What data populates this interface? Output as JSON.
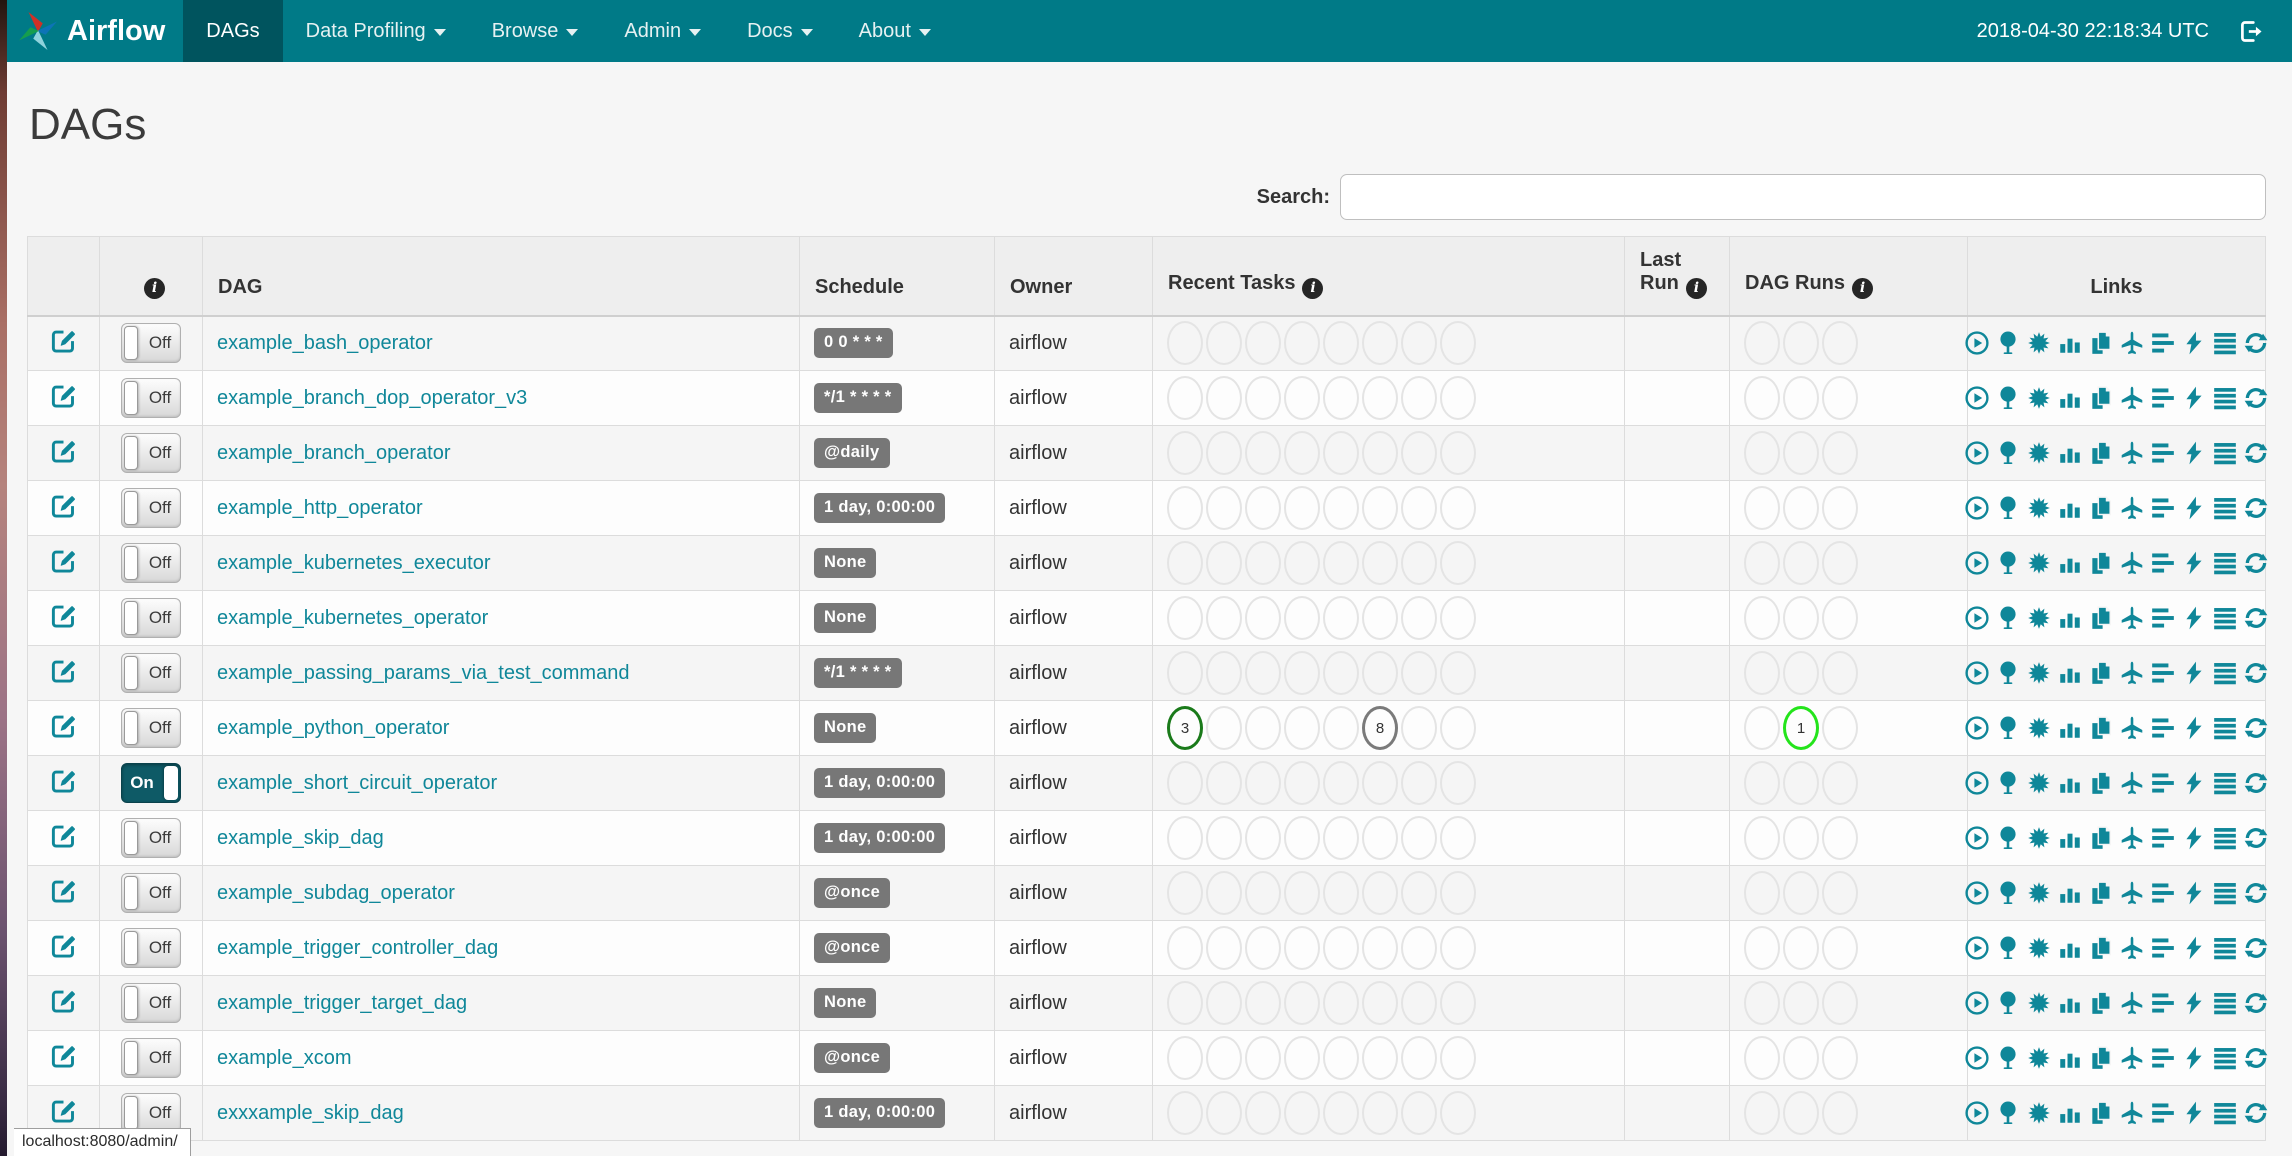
{
  "colors": {
    "navbar_bg": "#007a87",
    "navbar_active_bg": "#00545e",
    "accent_teal": "#0f8799",
    "toggle_on_bg": "#0e5a66",
    "schedule_badge_bg": "#777777",
    "state_success": "#1a7a1a",
    "state_queued": "#7a7a7a",
    "state_running": "#24e41b",
    "empty_circle_border": "#e4e4e4"
  },
  "navbar": {
    "brand": "Airflow",
    "items": [
      {
        "label": "DAGs",
        "active": true,
        "caret": false
      },
      {
        "label": "Data Profiling",
        "active": false,
        "caret": true
      },
      {
        "label": "Browse",
        "active": false,
        "caret": true
      },
      {
        "label": "Admin",
        "active": false,
        "caret": true
      },
      {
        "label": "Docs",
        "active": false,
        "caret": true
      },
      {
        "label": "About",
        "active": false,
        "caret": true
      }
    ],
    "clock": "2018-04-30 22:18:34 UTC"
  },
  "page": {
    "title": "DAGs",
    "search_label": "Search:",
    "search_value": "",
    "status_bar": "localhost:8080/admin/"
  },
  "table": {
    "info_glyph": "i",
    "columns": [
      {
        "label": "",
        "info": false,
        "name": "edit",
        "align": "left"
      },
      {
        "label": "",
        "info": true,
        "name": "toggle",
        "align": "center"
      },
      {
        "label": "DAG",
        "info": false,
        "name": "dag",
        "align": "left"
      },
      {
        "label": "Schedule",
        "info": false,
        "name": "schedule",
        "align": "left"
      },
      {
        "label": "Owner",
        "info": false,
        "name": "owner",
        "align": "left"
      },
      {
        "label": "Recent Tasks",
        "info": true,
        "name": "recent-tasks",
        "align": "left"
      },
      {
        "label": "Last Run",
        "info": true,
        "name": "last-run",
        "align": "left"
      },
      {
        "label": "DAG Runs",
        "info": true,
        "name": "dag-runs",
        "align": "left"
      },
      {
        "label": "Links",
        "info": false,
        "name": "links",
        "align": "center"
      }
    ],
    "recent_task_slots": 8,
    "dag_run_slots": 3,
    "link_icons": [
      "trigger-dag",
      "tree-view",
      "graph-view",
      "tasks-duration",
      "task-tries",
      "landing-times",
      "gantt",
      "code-view",
      "task-details",
      "refresh"
    ],
    "rows": [
      {
        "dag_id": "example_bash_operator",
        "toggle": "Off",
        "schedule": "0 0 * * *",
        "owner": "airflow",
        "last_run": "",
        "recent_tasks": [],
        "dag_runs": []
      },
      {
        "dag_id": "example_branch_dop_operator_v3",
        "toggle": "Off",
        "schedule": "*/1 * * * *",
        "owner": "airflow",
        "last_run": "",
        "recent_tasks": [],
        "dag_runs": []
      },
      {
        "dag_id": "example_branch_operator",
        "toggle": "Off",
        "schedule": "@daily",
        "owner": "airflow",
        "last_run": "",
        "recent_tasks": [],
        "dag_runs": []
      },
      {
        "dag_id": "example_http_operator",
        "toggle": "Off",
        "schedule": "1 day, 0:00:00",
        "owner": "airflow",
        "last_run": "",
        "recent_tasks": [],
        "dag_runs": []
      },
      {
        "dag_id": "example_kubernetes_executor",
        "toggle": "Off",
        "schedule": "None",
        "owner": "airflow",
        "last_run": "",
        "recent_tasks": [],
        "dag_runs": []
      },
      {
        "dag_id": "example_kubernetes_operator",
        "toggle": "Off",
        "schedule": "None",
        "owner": "airflow",
        "last_run": "",
        "recent_tasks": [],
        "dag_runs": []
      },
      {
        "dag_id": "example_passing_params_via_test_command",
        "toggle": "Off",
        "schedule": "*/1 * * * *",
        "owner": "airflow",
        "last_run": "",
        "recent_tasks": [],
        "dag_runs": []
      },
      {
        "dag_id": "example_python_operator",
        "toggle": "Off",
        "schedule": "None",
        "owner": "airflow",
        "last_run": "",
        "recent_tasks": [
          {
            "slot": 0,
            "value": "3",
            "state": "success"
          },
          {
            "slot": 5,
            "value": "8",
            "state": "queued"
          }
        ],
        "dag_runs": [
          {
            "slot": 1,
            "value": "1",
            "state": "running"
          }
        ]
      },
      {
        "dag_id": "example_short_circuit_operator",
        "toggle": "On",
        "schedule": "1 day, 0:00:00",
        "owner": "airflow",
        "last_run": "",
        "recent_tasks": [],
        "dag_runs": []
      },
      {
        "dag_id": "example_skip_dag",
        "toggle": "Off",
        "schedule": "1 day, 0:00:00",
        "owner": "airflow",
        "last_run": "",
        "recent_tasks": [],
        "dag_runs": []
      },
      {
        "dag_id": "example_subdag_operator",
        "toggle": "Off",
        "schedule": "@once",
        "owner": "airflow",
        "last_run": "",
        "recent_tasks": [],
        "dag_runs": []
      },
      {
        "dag_id": "example_trigger_controller_dag",
        "toggle": "Off",
        "schedule": "@once",
        "owner": "airflow",
        "last_run": "",
        "recent_tasks": [],
        "dag_runs": []
      },
      {
        "dag_id": "example_trigger_target_dag",
        "toggle": "Off",
        "schedule": "None",
        "owner": "airflow",
        "last_run": "",
        "recent_tasks": [],
        "dag_runs": []
      },
      {
        "dag_id": "example_xcom",
        "toggle": "Off",
        "schedule": "@once",
        "owner": "airflow",
        "last_run": "",
        "recent_tasks": [],
        "dag_runs": []
      },
      {
        "dag_id": "exxxample_skip_dag",
        "toggle": "Off",
        "schedule": "1 day, 0:00:00",
        "owner": "airflow",
        "last_run": "",
        "recent_tasks": [],
        "dag_runs": []
      }
    ]
  }
}
